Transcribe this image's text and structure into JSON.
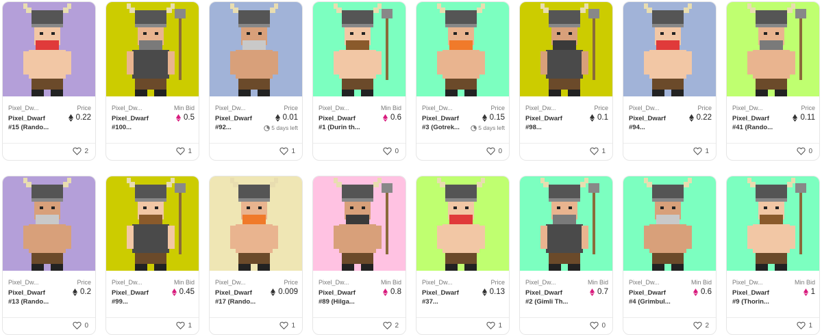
{
  "colors": {
    "purple": "#B49FD9",
    "olive": "#CCCC00",
    "blue": "#A1B3D8",
    "mint": "#7CFFC0",
    "lime": "#BFFF70",
    "cream": "#EFE6B4",
    "pink": "#FFC2E2",
    "eth_icon": "#333333",
    "bid_icon": "#D81B7D"
  },
  "cards": [
    {
      "bg": "purple",
      "collection": "Pixel_Dw...",
      "name": "Pixel_Dwarf",
      "number": "#15 (Rando...",
      "price_label": "Price",
      "price": "0.22",
      "currency_icon": "ethereum-icon",
      "time_left": "",
      "likes": "2"
    },
    {
      "bg": "olive",
      "collection": "Pixel_Dw...",
      "name": "Pixel_Dwarf",
      "number": "#100...",
      "price_label": "Min Bid",
      "price": "0.5",
      "currency_icon": "weth-icon",
      "time_left": "",
      "likes": "1"
    },
    {
      "bg": "blue",
      "collection": "Pixel_Dw...",
      "name": "Pixel_Dwarf",
      "number": "#92...",
      "price_label": "Price",
      "price": "0.01",
      "currency_icon": "ethereum-icon",
      "time_left": "5 days left",
      "likes": "1"
    },
    {
      "bg": "mint",
      "collection": "Pixel_Dw...",
      "name": "Pixel_Dwarf",
      "number": "#1 (Durin th...",
      "price_label": "Min Bid",
      "price": "0.6",
      "currency_icon": "weth-icon",
      "time_left": "",
      "likes": "0"
    },
    {
      "bg": "mint",
      "collection": "Pixel_Dw...",
      "name": "Pixel_Dwarf",
      "number": "#3 (Gotrek...",
      "price_label": "Price",
      "price": "0.15",
      "currency_icon": "ethereum-icon",
      "time_left": "5 days left",
      "likes": "0"
    },
    {
      "bg": "olive",
      "collection": "Pixel_Dw...",
      "name": "Pixel_Dwarf",
      "number": "#98...",
      "price_label": "Price",
      "price": "0.1",
      "currency_icon": "ethereum-icon",
      "time_left": "",
      "likes": "1"
    },
    {
      "bg": "blue",
      "collection": "Pixel_Dw...",
      "name": "Pixel_Dwarf",
      "number": "#94...",
      "price_label": "Price",
      "price": "0.22",
      "currency_icon": "ethereum-icon",
      "time_left": "",
      "likes": "1"
    },
    {
      "bg": "lime",
      "collection": "Pixel_Dw...",
      "name": "Pixel_Dwarf",
      "number": "#41 (Rando...",
      "price_label": "Price",
      "price": "0.11",
      "currency_icon": "ethereum-icon",
      "time_left": "",
      "likes": "0"
    },
    {
      "bg": "purple",
      "collection": "Pixel_Dw...",
      "name": "Pixel_Dwarf",
      "number": "#13 (Rando...",
      "price_label": "Price",
      "price": "0.2",
      "currency_icon": "ethereum-icon",
      "time_left": "",
      "likes": "0"
    },
    {
      "bg": "olive",
      "collection": "Pixel_Dw...",
      "name": "Pixel_Dwarf",
      "number": "#99...",
      "price_label": "Min Bid",
      "price": "0.45",
      "currency_icon": "weth-icon",
      "time_left": "",
      "likes": "1"
    },
    {
      "bg": "cream",
      "collection": "Pixel_Dw...",
      "name": "Pixel_Dwarf",
      "number": "#17 (Rando...",
      "price_label": "Price",
      "price": "0.009",
      "currency_icon": "ethereum-icon",
      "time_left": "",
      "likes": "1"
    },
    {
      "bg": "pink",
      "collection": "Pixel_Dw...",
      "name": "Pixel_Dwarf",
      "number": "#89 (Hilga...",
      "price_label": "Min Bid",
      "price": "0.8",
      "currency_icon": "weth-icon",
      "time_left": "",
      "likes": "2"
    },
    {
      "bg": "lime",
      "collection": "Pixel_Dw...",
      "name": "Pixel_Dwarf",
      "number": "#37...",
      "price_label": "Price",
      "price": "0.13",
      "currency_icon": "ethereum-icon",
      "time_left": "",
      "likes": "1"
    },
    {
      "bg": "mint",
      "collection": "Pixel_Dw...",
      "name": "Pixel_Dwarf",
      "number": "#2 (Gimli Th...",
      "price_label": "Min Bid",
      "price": "0.7",
      "currency_icon": "weth-icon",
      "time_left": "",
      "likes": "0"
    },
    {
      "bg": "mint",
      "collection": "Pixel_Dw...",
      "name": "Pixel_Dwarf",
      "number": "#4 (Grimbul...",
      "price_label": "Min Bid",
      "price": "0.6",
      "currency_icon": "weth-icon",
      "time_left": "",
      "likes": "2"
    },
    {
      "bg": "mint",
      "collection": "Pixel_Dw...",
      "name": "Pixel_Dwarf",
      "number": "#9 (Thorin...",
      "price_label": "Min Bid",
      "price": "1",
      "currency_icon": "weth-icon",
      "time_left": "",
      "likes": "1"
    }
  ]
}
